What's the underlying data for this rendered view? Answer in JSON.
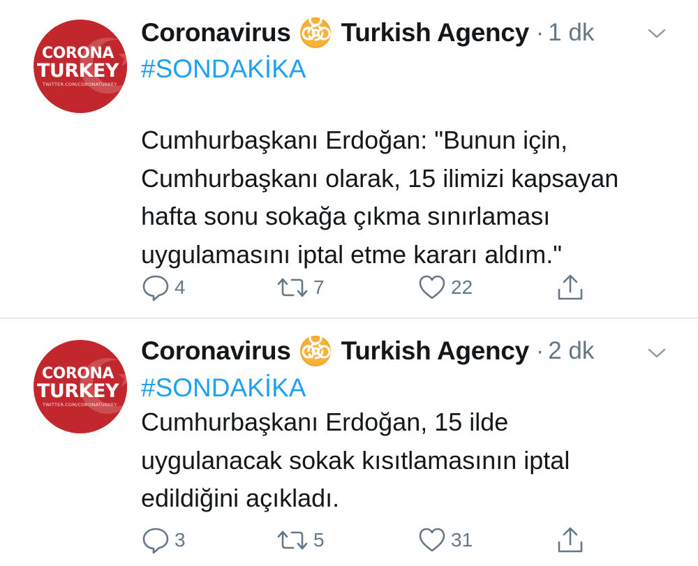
{
  "tweets": [
    {
      "account": {
        "display_name_part1": "Coronavirus",
        "display_name_part2": "Turkish Agency",
        "name_emoji": "biohazard-icon",
        "avatar_logo_line1": "CORONA",
        "avatar_logo_line2": "TURKEY",
        "avatar_logo_line3": "TWITTER.COM/CORONATURKEY"
      },
      "separator": "·",
      "time": "1 dk",
      "hashtag": "#SONDAKİKA",
      "text": "Cumhurbaşkanı Erdoğan: \"Bunun için,\nCumhurbaşkanı olarak, 15 ilimizi kapsayan\nhafta sonu sokağa çıkma sınırlaması\nuygulamasını iptal etme kararı aldım.\"",
      "counts": {
        "replies": "4",
        "retweets": "7",
        "likes": "22"
      }
    },
    {
      "account": {
        "display_name_part1": "Coronavirus",
        "display_name_part2": "Turkish Agency",
        "name_emoji": "biohazard-icon",
        "avatar_logo_line1": "CORONA",
        "avatar_logo_line2": "TURKEY",
        "avatar_logo_line3": "TWITTER.COM/CORONATURKEY"
      },
      "separator": "·",
      "time": "2 dk",
      "hashtag": "#SONDAKİKA",
      "text": "Cumhurbaşkanı Erdoğan, 15 ilde\nuygulanacak sokak kısıtlamasının iptal\nedildiğini açıkladı.",
      "counts": {
        "replies": "3",
        "retweets": "5",
        "likes": "31"
      }
    }
  ],
  "colors": {
    "link": "#1da1f2",
    "secondary_text": "#657786",
    "primary_text": "#14171a",
    "avatar_red": "#c1272d",
    "biohazard_orange": "#f5a623",
    "divider": "#e6ecf0"
  },
  "icons": {
    "reply": "reply-icon",
    "retweet": "retweet-icon",
    "like": "heart-icon",
    "share": "share-icon",
    "menu": "chevron-down-icon"
  }
}
